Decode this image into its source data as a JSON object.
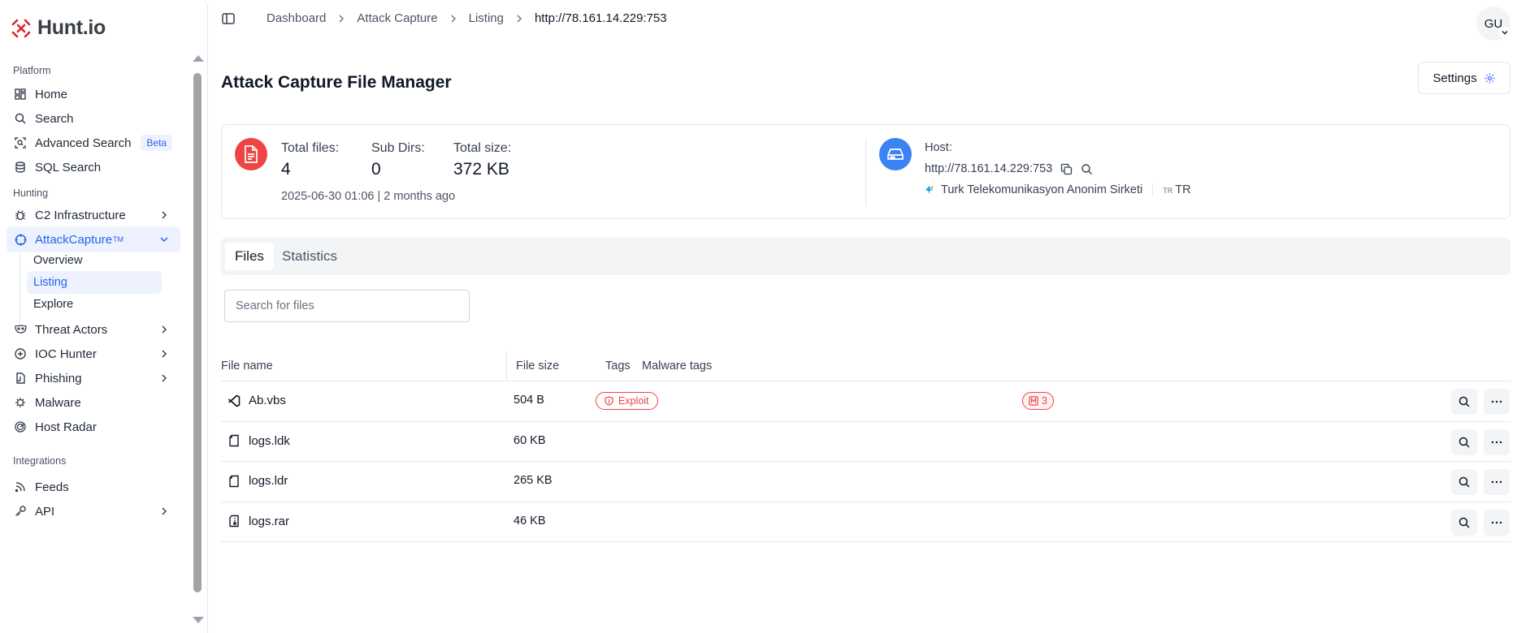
{
  "app": {
    "logo_text": "Hunt.io"
  },
  "sidebar": {
    "sections": {
      "platform": "Platform",
      "hunting": "Hunting",
      "integrations": "Integrations"
    },
    "items": {
      "home": "Home",
      "search": "Search",
      "advanced_search": "Advanced Search",
      "beta_badge": "Beta",
      "sql_search": "SQL Search",
      "c2_infrastructure": "C2 Infrastructure",
      "attackcapture": "AttackCapture",
      "attackcapture_tm": "TM",
      "overview": "Overview",
      "listing": "Listing",
      "explore": "Explore",
      "threat_actors": "Threat Actors",
      "ioc_hunter": "IOC Hunter",
      "phishing": "Phishing",
      "malware": "Malware",
      "host_radar": "Host Radar",
      "feeds": "Feeds",
      "api": "API"
    }
  },
  "breadcrumb": [
    "Dashboard",
    "Attack Capture",
    "Listing",
    "http://78.161.14.229:753"
  ],
  "user": {
    "initials": "GU"
  },
  "page": {
    "title": "Attack Capture File Manager",
    "settings_label": "Settings"
  },
  "summary": {
    "total_files_label": "Total files:",
    "total_files": "4",
    "sub_dirs_label": "Sub Dirs:",
    "sub_dirs": "0",
    "total_size_label": "Total size:",
    "total_size": "372 KB",
    "timestamp": "2025-06-30 01:06 | 2 months ago",
    "host_label": "Host:",
    "host_url": "http://78.161.14.229:753",
    "org": "Turk Telekomunikasyon Anonim Sirketi",
    "country_code_small": "TR",
    "country": "TR"
  },
  "tabs": [
    "Files",
    "Statistics"
  ],
  "search": {
    "placeholder": "Search for files"
  },
  "table": {
    "headers": {
      "name": "File name",
      "size": "File size",
      "tags": "Tags",
      "malware_tags": "Malware tags"
    },
    "rows": [
      {
        "name": "Ab.vbs",
        "size": "504 B",
        "icon": "vbs-file-icon",
        "tag": "Exploit",
        "malware_count": "3"
      },
      {
        "name": "logs.ldk",
        "size": "60 KB",
        "icon": "file-icon"
      },
      {
        "name": "logs.ldr",
        "size": "265 KB",
        "icon": "file-icon"
      },
      {
        "name": "logs.rar",
        "size": "46 KB",
        "icon": "archive-file-icon"
      }
    ]
  },
  "colors": {
    "accent": "#2563eb",
    "danger": "#ef4444",
    "info": "#3b82f6",
    "logo": "#dc2626"
  }
}
